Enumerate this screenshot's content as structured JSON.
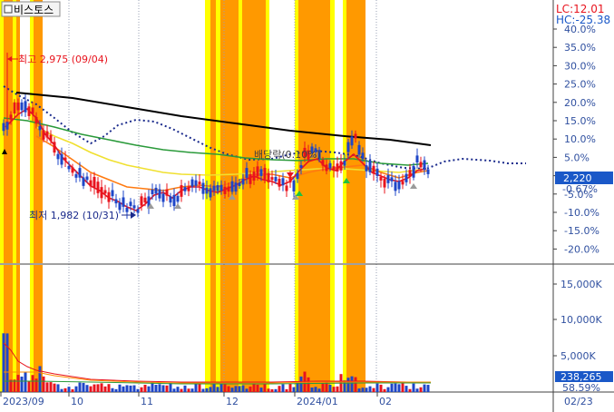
{
  "header": {
    "title": "비스토스",
    "lc_label": "LC:12.01",
    "hc_label": "HC:-25.38"
  },
  "price_axis": {
    "ticks": [
      "40.0%",
      "35.0%",
      "30.0%",
      "25.0%",
      "20.0%",
      "15.0%",
      "10.0%",
      "5.0%",
      "0.0%",
      "-5.0%",
      "-10.0%",
      "-15.0%",
      "-20.0%"
    ],
    "current_price": "2,220",
    "current_change": "-0.67%"
  },
  "volume_axis": {
    "ticks": [
      "15,000K",
      "10,000K",
      "5,000K"
    ],
    "current_volume": "238,265",
    "current_ratio": "58.59%"
  },
  "annotations": {
    "high": "최고 2,975 (09/04)",
    "low": "최저 1,982 (10/31)",
    "dividend": "배당락(0.10%)"
  },
  "time_axis": {
    "labels": [
      "2023/09",
      "10",
      "11",
      "12",
      "2024/01",
      "02"
    ],
    "future_label": "02/23"
  },
  "colors": {
    "highlight_yellow": "#ffff00",
    "highlight_orange": "#ff9900",
    "up_candle": "#e8141e",
    "down_candle": "#1e46c8",
    "ma_short": "#e8141e",
    "ma_mid": "#ff8c00",
    "ma_long": "#f0e030",
    "ma_longer": "#2a9a3a",
    "trend_line": "#000000",
    "forecast_dots": "#1a2a8c",
    "axis_text": "#3050a0",
    "price_badge": "#1a58c8"
  },
  "chart_data": {
    "type": "candlestick",
    "price_range_pct": [
      -23,
      43
    ],
    "high": {
      "value": 2975,
      "date": "09/04"
    },
    "low": {
      "value": 1982,
      "date": "10/31"
    },
    "last_close": 2220,
    "last_change_pct": -0.67,
    "last_volume": 238265
  }
}
